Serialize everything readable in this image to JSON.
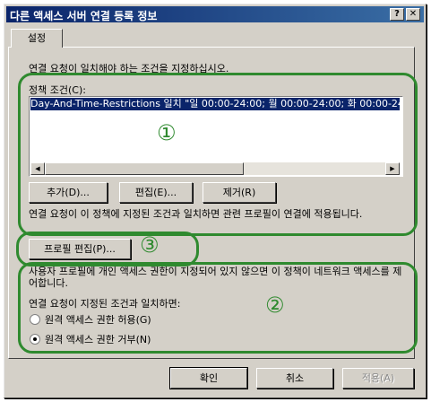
{
  "window": {
    "title": "다른 액세스 서버 연결 등록 정보",
    "help_label": "?",
    "close_label": "✕"
  },
  "tabs": [
    {
      "label": "설정"
    }
  ],
  "conditions": {
    "intro": "연결 요청이 일치해야 하는 조건을 지정하십시오.",
    "label": "정책 조건(C):",
    "list_items": [
      "Day-And-Time-Restrictions 일치 \"일 00:00-24:00; 월 00:00-24:00; 화 00:00-24:00\""
    ],
    "scroll_left": "◀",
    "scroll_right": "▶",
    "add_label": "추가(D)...",
    "edit_label": "편집(E)...",
    "remove_label": "제거(R)",
    "note": "연결 요청이 이 정책에 지정된 조건과 일치하면 관련 프로필이 연결에 적용됩니다."
  },
  "profile": {
    "edit_label": "프로필 편집(P)..."
  },
  "access": {
    "desc": "사용자 프로필에 개인 액세스 권한이 지정되어 있지 않으면 이 정책이 네트워크 액세스를 제어합니다.",
    "match_label": "연결 요청이 지정된 조건과 일치하면:",
    "grant_label": "원격 액세스 권한 허용(G)",
    "deny_label": "원격 액세스 권한 거부(N)",
    "selected": "deny"
  },
  "annotations": {
    "one": "①",
    "two": "②",
    "three": "③",
    "color": "#2f8a2f"
  },
  "footer": {
    "ok_label": "확인",
    "cancel_label": "취소",
    "apply_label": "적용(A)"
  }
}
